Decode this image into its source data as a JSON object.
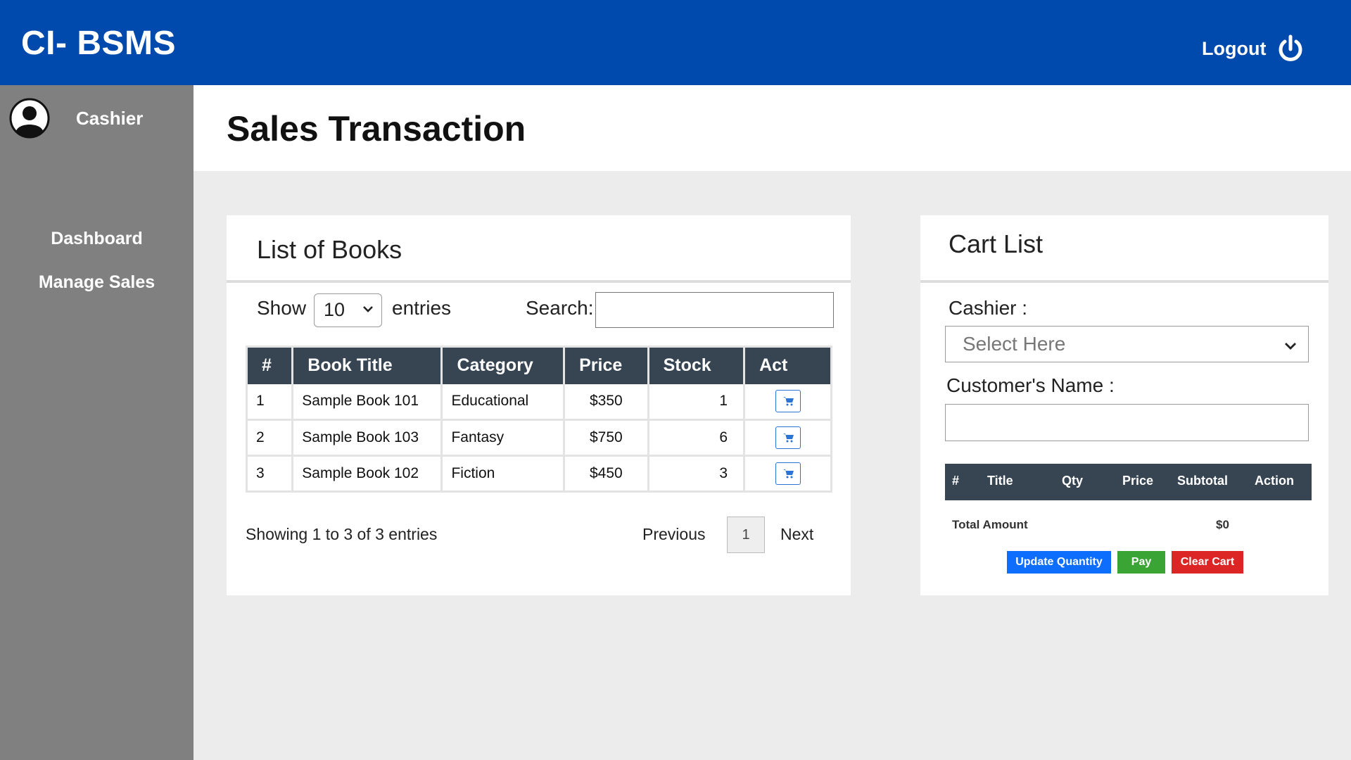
{
  "app": {
    "brand": "CI- BSMS",
    "logout_label": "Logout"
  },
  "sidebar": {
    "user_role": "Cashier",
    "items": [
      {
        "label": "Dashboard"
      },
      {
        "label": "Manage Sales"
      }
    ]
  },
  "page": {
    "title": "Sales Transaction"
  },
  "books_panel": {
    "title": "List of Books",
    "show_label": "Show",
    "entries_value": "10",
    "entries_label": "entries",
    "search_label": "Search:",
    "search_value": "",
    "columns": [
      "#",
      "Book Title",
      "Category",
      "Price",
      "Stock",
      "Act"
    ],
    "rows": [
      {
        "num": "1",
        "title": "Sample Book 101",
        "category": "Educational",
        "price": "$350",
        "stock": "1"
      },
      {
        "num": "2",
        "title": "Sample Book 103",
        "category": "Fantasy",
        "price": "$750",
        "stock": "6"
      },
      {
        "num": "3",
        "title": "Sample Book 102",
        "category": "Fiction",
        "price": "$450",
        "stock": "3"
      }
    ],
    "showing_text": "Showing 1 to 3 of 3 entries",
    "pagination": {
      "previous": "Previous",
      "current_page": "1",
      "next": "Next"
    }
  },
  "cart_panel": {
    "title": "Cart List",
    "cashier_label": "Cashier :",
    "cashier_placeholder": "Select Here",
    "customer_label": "Customer's Name :",
    "customer_value": "",
    "columns": [
      "#",
      "Title",
      "Qty",
      "Price",
      "Subtotal",
      "Action"
    ],
    "total_label": "Total Amount",
    "total_value": "$0",
    "buttons": {
      "update": "Update Quantity",
      "pay": "Pay",
      "clear": "Clear Cart"
    }
  },
  "colors": {
    "header_bg": "#004aad",
    "sidebar_bg": "#808080",
    "table_header_bg": "#374553",
    "update_button": "#0d6efd",
    "pay_button": "#3aa535",
    "clear_button": "#dc2626"
  },
  "icons": {
    "logout": "power-icon",
    "user": "user-circle-icon",
    "add_to_cart": "cart-icon"
  }
}
